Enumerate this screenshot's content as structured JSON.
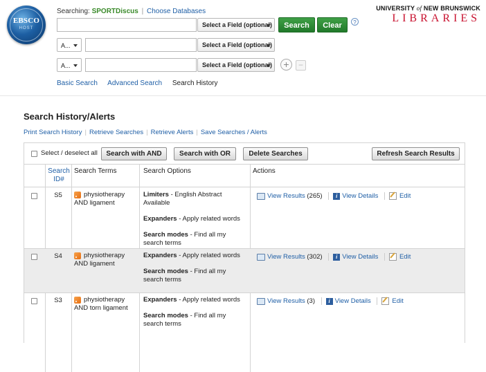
{
  "header": {
    "logo_text": "EBSCO",
    "logo_subtext": "HOST",
    "searching_label": "Searching:",
    "database": "SPORTDiscus",
    "choose_databases": "Choose Databases",
    "university_top": "UNIVERSITY",
    "university_of": "of",
    "university_name": "NEW BRUNSWICK",
    "libraries": "LIBRARIES"
  },
  "search": {
    "rows": [
      {
        "operator": "",
        "value": "",
        "field": "Select a Field (optional)"
      },
      {
        "operator": "A...",
        "value": "",
        "field": "Select a Field (optional)"
      },
      {
        "operator": "A...",
        "value": "",
        "field": "Select a Field (optional)"
      }
    ],
    "search_button": "Search",
    "clear_button": "Clear",
    "help": "?",
    "add": "+",
    "remove": "−"
  },
  "nav": {
    "basic": "Basic Search",
    "advanced": "Advanced Search",
    "history": "Search History"
  },
  "history": {
    "title": "Search History/Alerts",
    "links": [
      "Print Search History",
      "Retrieve Searches",
      "Retrieve Alerts",
      "Save Searches / Alerts"
    ],
    "select_all": "Select / deselect all",
    "btn_and": "Search with AND",
    "btn_or": "Search with OR",
    "btn_delete": "Delete Searches",
    "btn_refresh": "Refresh Search Results",
    "col_id": "Search ID#",
    "col_terms": "Search Terms",
    "col_options": "Search Options",
    "col_actions": "Actions",
    "view_results": "View Results",
    "view_details": "View Details",
    "edit": "Edit",
    "rows": [
      {
        "id": "S5",
        "terms": "physiotherapy AND ligament",
        "options": [
          {
            "label": "Limiters",
            "text": " - English Abstract Available"
          },
          {
            "label": "Expanders",
            "text": " - Apply related words"
          },
          {
            "label": "Search modes",
            "text": " - Find all my search terms"
          }
        ],
        "count": "(265)"
      },
      {
        "id": "S4",
        "terms": "physiotherapy AND ligament",
        "options": [
          {
            "label": "Expanders",
            "text": " - Apply related words"
          },
          {
            "label": "Search modes",
            "text": " - Find all my search terms"
          }
        ],
        "count": "(302)"
      },
      {
        "id": "S3",
        "terms": "physiotherapy AND torn ligament",
        "options": [
          {
            "label": "Expanders",
            "text": " - Apply related words"
          },
          {
            "label": "Search modes",
            "text": " - Find all my search terms"
          }
        ],
        "count": "(3)"
      }
    ]
  }
}
